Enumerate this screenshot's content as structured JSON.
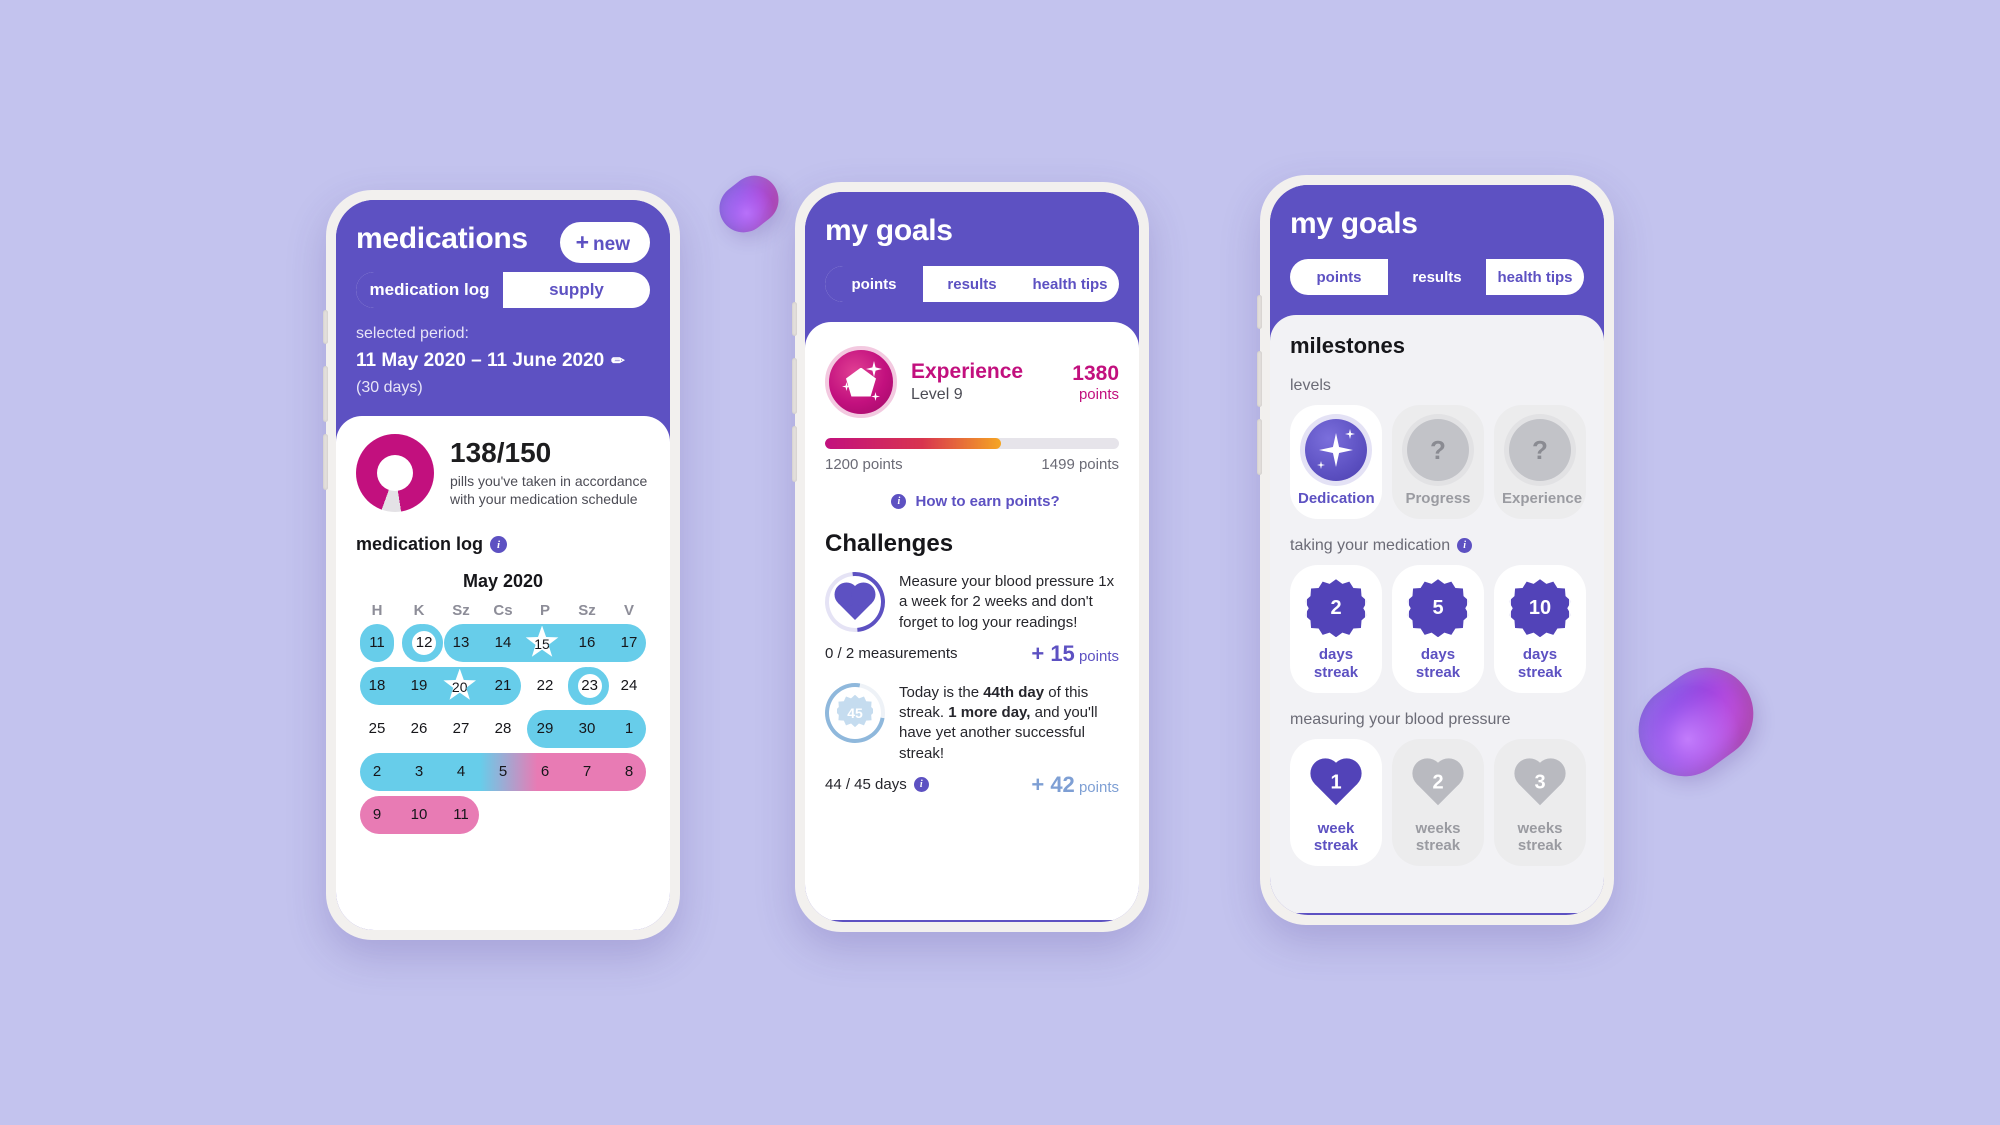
{
  "background_color": "#c3c3ee",
  "accent_purple": "#5d51c2",
  "accent_magenta": "#c2107e",
  "accent_blue": "#67cdea",
  "accent_pink": "#e87bb4",
  "phone1": {
    "title": "medications",
    "new_button": {
      "plus": "+",
      "label": "new"
    },
    "tabs": [
      {
        "label": "medication log",
        "active": true
      },
      {
        "label": "supply",
        "active": false
      }
    ],
    "period": {
      "label": "selected period:",
      "range": "11 May 2020  –  11 June 2020",
      "pencil_icon": "✏",
      "days": "(30 days)"
    },
    "stat": {
      "value": "138/150",
      "description": "pills you've taken in accordance with your medication schedule",
      "taken": 138,
      "total": 150
    },
    "log_label": "medication log",
    "info_icon": "i",
    "calendar": {
      "month": "May 2020",
      "dow": [
        "H",
        "K",
        "Sz",
        "Cs",
        "P",
        "Sz",
        "V"
      ],
      "rows": [
        {
          "days": [
            "11",
            "12",
            "13",
            "14",
            "15",
            "16",
            "17"
          ]
        },
        {
          "days": [
            "18",
            "19",
            "20",
            "21",
            "22",
            "23",
            "24"
          ]
        },
        {
          "days": [
            "25",
            "26",
            "27",
            "28",
            "29",
            "30",
            "1"
          ]
        },
        {
          "days": [
            "2",
            "3",
            "4",
            "5",
            "6",
            "7",
            "8"
          ]
        },
        {
          "days": [
            "9",
            "10",
            "11",
            "",
            "",
            "",
            ""
          ]
        }
      ]
    }
  },
  "phone2": {
    "title": "my goals",
    "tabs": [
      {
        "label": "points",
        "active": true
      },
      {
        "label": "results",
        "active": false
      },
      {
        "label": "health tips",
        "active": false
      }
    ],
    "experience": {
      "title": "Experience",
      "level": "Level 9",
      "points": "1380",
      "points_label": "points",
      "progress_min": "1200 points",
      "progress_max": "1499 points",
      "progress_percent": 60
    },
    "how_to_earn": "How to earn points?",
    "info_icon": "i",
    "challenges_title": "Challenges",
    "challenges": [
      {
        "icon": "heart-icon",
        "text": "Measure your blood pressure 1x a week for 2 weeks and don't forget to log your readings!",
        "progress": "0 / 2 measurements",
        "plus": "+",
        "points_value": "15",
        "points_label": "points",
        "has_info": false
      },
      {
        "icon": "streak-badge-icon",
        "badge_number": "45",
        "text_parts": [
          "Today is the ",
          "44th day",
          " of this streak. ",
          "1 more day,",
          " and you'll have yet another successful streak!"
        ],
        "progress": "44 / 45 days",
        "plus": "+",
        "points_value": "42",
        "points_label": "points",
        "has_info": true
      }
    ]
  },
  "phone3": {
    "title": "my goals",
    "tabs": [
      {
        "label": "points",
        "active": false
      },
      {
        "label": "results",
        "active": true
      },
      {
        "label": "health tips",
        "active": false
      }
    ],
    "milestones_title": "milestones",
    "sections": [
      {
        "label": "levels",
        "has_info": false,
        "tiles": [
          {
            "label": "Dedication",
            "unlocked": true,
            "icon": "sparkle-icon"
          },
          {
            "label": "Progress",
            "unlocked": false,
            "icon": "question-icon",
            "glyph": "?"
          },
          {
            "label": "Experience",
            "unlocked": false,
            "icon": "question-icon",
            "glyph": "?"
          }
        ]
      },
      {
        "label": "taking your medication",
        "has_info": true,
        "tiles": [
          {
            "number": "2",
            "label": "days\nstreak",
            "unlocked": true,
            "icon": "star-burst-icon"
          },
          {
            "number": "5",
            "label": "days\nstreak",
            "unlocked": true,
            "icon": "star-burst-icon"
          },
          {
            "number": "10",
            "label": "days\nstreak",
            "unlocked": true,
            "icon": "star-burst-icon"
          }
        ]
      },
      {
        "label": "measuring your blood pressure",
        "has_info": false,
        "tiles": [
          {
            "number": "1",
            "label": "week\nstreak",
            "unlocked": true,
            "icon": "heart-badge-icon"
          },
          {
            "number": "2",
            "label": "weeks\nstreak",
            "unlocked": false,
            "icon": "heart-badge-icon"
          },
          {
            "number": "3",
            "label": "weeks\nstreak",
            "unlocked": false,
            "icon": "heart-badge-icon"
          }
        ]
      }
    ],
    "info_icon": "i"
  }
}
